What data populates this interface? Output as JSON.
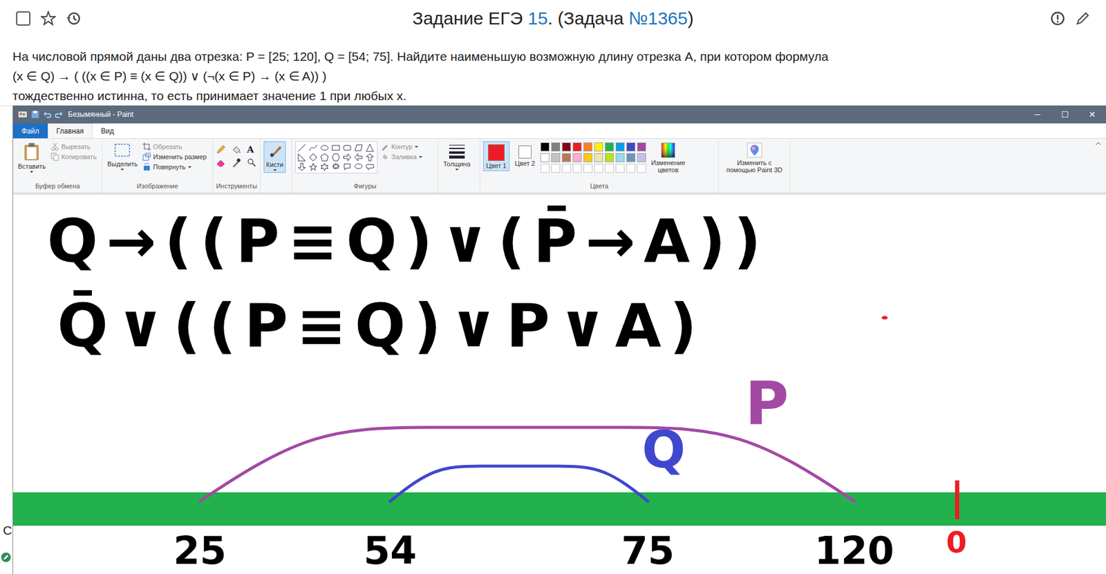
{
  "header": {
    "title_before": "Задание ЕГЭ ",
    "task_number": "15",
    "title_middle": ". (Задача ",
    "task_id": "№1365",
    "title_after": ")"
  },
  "problem": [
    "На числовой прямой даны два отрезка: P = [25; 120], Q = [54; 75]. Найдите наименьшую возможную длину отрезка A, при котором формула",
    "(x ∈ Q) → ( ((x ∈ P) ≡ (x ∈ Q)) ∨ (¬(x ∈ P) → (x ∈ A)) )",
    "тождественно истинна, то есть принимает значение 1 при любых x."
  ],
  "left_edge": {
    "letter": "С"
  },
  "paint": {
    "title": "Безымянный - Paint",
    "window_buttons": [
      "─",
      "☐",
      "✕"
    ],
    "tabs": [
      {
        "label": "Файл",
        "kind": "file",
        "selected": false
      },
      {
        "label": "Главная",
        "kind": "tab",
        "selected": true
      },
      {
        "label": "Вид",
        "kind": "tab",
        "selected": false
      }
    ],
    "ribbon": {
      "clipboard": {
        "label": "Буфер обмена",
        "paste": "Вставить",
        "cut": "Вырезать",
        "copy": "Копировать"
      },
      "image": {
        "label": "Изображение",
        "select": "Выделить",
        "crop": "Обрезать",
        "resize": "Изменить размер",
        "rotate": "Повернуть"
      },
      "tools": {
        "label": "Инструменты",
        "text_tool": "A"
      },
      "brushes": {
        "label": "Кисти",
        "selected": true
      },
      "shapes": {
        "label": "Фигуры",
        "outline": "Контур",
        "fill": "Заливка"
      },
      "size": {
        "label": "Толщина"
      },
      "colors": {
        "label": "Цвета",
        "color1": {
          "label": "Цвет 1",
          "color": "#ed1c24",
          "selected": true
        },
        "color2": {
          "label": "Цвет 2",
          "color": "#ffffff",
          "selected": false
        },
        "palette": [
          "#000000",
          "#7f7f7f",
          "#880015",
          "#ed1c24",
          "#ff7f27",
          "#fff200",
          "#22b14c",
          "#00a2e8",
          "#3f48cc",
          "#a349a4",
          "#ffffff",
          "#c3c3c3",
          "#b97a57",
          "#ffaec9",
          "#ffc90e",
          "#efe4b0",
          "#b5e61d",
          "#99d9ea",
          "#7092be",
          "#c8bfe7"
        ],
        "edit": "Изменение цветов"
      },
      "paint3d": {
        "label": "Изменить с помощью Paint 3D"
      }
    },
    "canvas": {
      "formulas": [
        "Q→((P≡Q)∨(P̄→A))",
        "Q̄∨((P≡Q)∨P∨A)"
      ],
      "axis_labels": [
        "25",
        "54",
        "75",
        "120"
      ],
      "segments": [
        {
          "label": "P",
          "color": "#a349a4",
          "from": "25",
          "to": "120"
        },
        {
          "label": "Q",
          "color": "#3f48cc",
          "from": "54",
          "to": "75"
        }
      ],
      "marker": {
        "label": "0",
        "color": "#ed1c24"
      }
    }
  }
}
